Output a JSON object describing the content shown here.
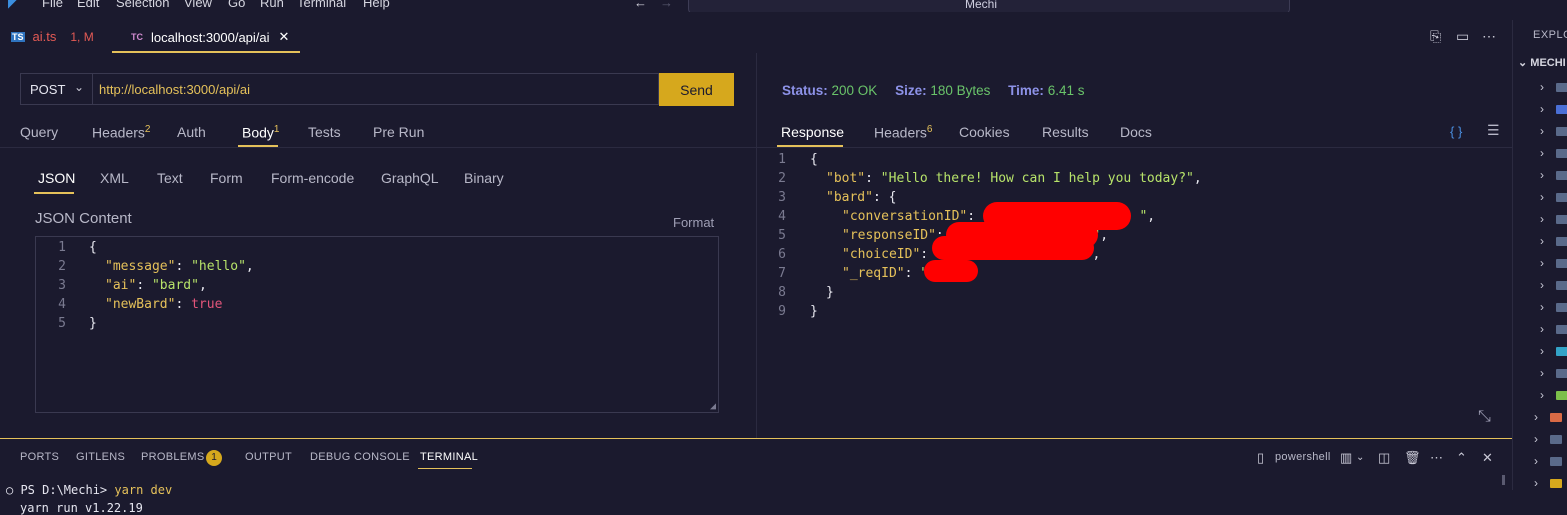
{
  "titlebar": {
    "menu": [
      "File",
      "Edit",
      "Selection",
      "View",
      "Go",
      "Run",
      "Terminal",
      "Help"
    ],
    "search_text": "Mechi"
  },
  "tabs": [
    {
      "icon_text": "TS",
      "label": "ai.ts",
      "status": "1, M"
    },
    {
      "icon_text": "TC",
      "label": "localhost:3000/api/ai",
      "close": "✕"
    }
  ],
  "request": {
    "method": "POST",
    "url": "http://localhost:3000/api/ai",
    "send_label": "Send",
    "tabs": [
      {
        "label": "Query"
      },
      {
        "label": "Headers",
        "count": "2"
      },
      {
        "label": "Auth"
      },
      {
        "label": "Body",
        "count": "1"
      },
      {
        "label": "Tests"
      },
      {
        "label": "Pre Run"
      }
    ],
    "body_tabs": [
      "JSON",
      "XML",
      "Text",
      "Form",
      "Form-encode",
      "GraphQL",
      "Binary"
    ],
    "json_label": "JSON Content",
    "format_label": "Format",
    "code_lines": [
      "1",
      "2",
      "3",
      "4",
      "5"
    ],
    "code": {
      "open": "{",
      "l2_key": "\"message\"",
      "l2_val": "\"hello\"",
      "l3_key": "\"ai\"",
      "l3_val": "\"bard\"",
      "l4_key": "\"newBard\"",
      "l4_val": "true",
      "close": "}"
    }
  },
  "response": {
    "status_label": "Status:",
    "status_value": "200 OK",
    "size_label": "Size:",
    "size_value": "180 Bytes",
    "time_label": "Time:",
    "time_value": "6.41 s",
    "tabs": [
      {
        "label": "Response"
      },
      {
        "label": "Headers",
        "count": "6"
      },
      {
        "label": "Cookies"
      },
      {
        "label": "Results"
      },
      {
        "label": "Docs"
      }
    ],
    "code_lines": [
      "1",
      "2",
      "3",
      "4",
      "5",
      "6",
      "7",
      "8",
      "9"
    ],
    "code": {
      "open": "{",
      "bot_key": "\"bot\"",
      "bot_val": "\"Hello there! How can I help you today?\"",
      "bard_key": "\"bard\"",
      "conv_key": "\"conversationID\"",
      "resp_key": "\"responseID\"",
      "choice_key": "\"choiceID\"",
      "req_key": "\"_reqID\"",
      "inner_close": "}",
      "close": "}"
    }
  },
  "explorer": {
    "title": "EXPLOR",
    "root": "MECHI"
  },
  "panel": {
    "tabs": [
      "PORTS",
      "GITLENS",
      "PROBLEMS",
      "OUTPUT",
      "DEBUG CONSOLE",
      "TERMINAL"
    ],
    "problems_count": "1",
    "shell": "powershell",
    "prompt": "PS D:\\Mechi>",
    "command": "yarn dev",
    "output_line": "yarn run v1.22.19"
  },
  "colors": {
    "background": "#1b1a2e",
    "accent": "#d6a81d",
    "status_ok": "#6ac46a",
    "redaction": "#ff0000"
  }
}
